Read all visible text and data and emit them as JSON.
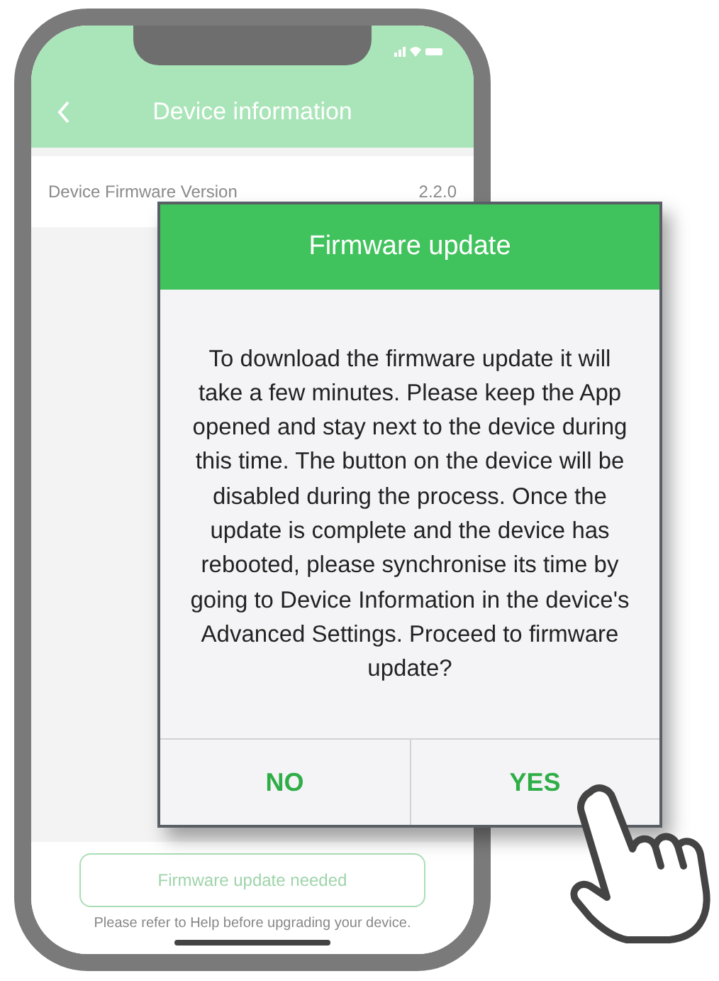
{
  "app_header": {
    "title": "Device information"
  },
  "info_rows": [
    {
      "label": "Device Firmware Version",
      "value": "2.2.0"
    }
  ],
  "update_button": {
    "label": "Firmware update needed"
  },
  "footer_note": "Please refer to Help before upgrading your device.",
  "dialog": {
    "title": "Firmware update",
    "message": "To download the firmware update it will take a few minutes. Please keep the App opened and stay next to the device during this time. The button on the device will be disabled during the process. Once the update is complete and the device has rebooted, please synchronise its time by going to Device Information in the device's Advanced Settings. Proceed to firmware update?",
    "buttons": [
      {
        "label": "NO"
      },
      {
        "label": "YES"
      }
    ]
  }
}
